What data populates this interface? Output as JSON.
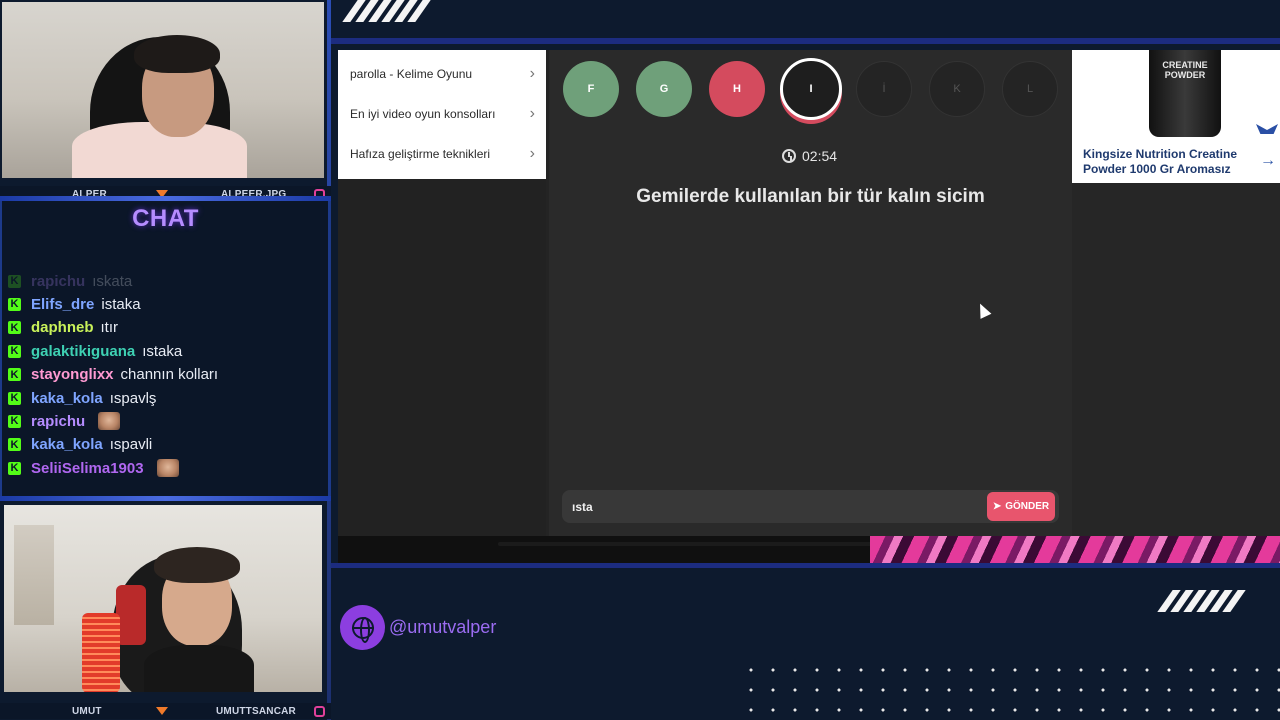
{
  "stream": {
    "streamer_top": {
      "name": "ALPER",
      "handle": "ALPEER.JPG"
    },
    "streamer_bottom": {
      "name": "UMUT",
      "handle": "UMUTTSANCAR"
    },
    "social_handle": "@umutvalper"
  },
  "chat": {
    "title": "CHAT",
    "messages": [
      {
        "user": "rapichu",
        "text": "ıskata",
        "color": "#b58cff",
        "faded": true
      },
      {
        "user": "Elifs_dre",
        "text": "istaka",
        "color": "#7fa5ff"
      },
      {
        "user": "daphneb",
        "text": "ıtır",
        "color": "#c9f25a"
      },
      {
        "user": "galaktikiguana",
        "text": "ıstaka",
        "color": "#3ed1b3"
      },
      {
        "user": "stayonglixx",
        "text": "channın kolları",
        "color": "#ff9ad2"
      },
      {
        "user": "kaka_kola",
        "text": "ıspavlş",
        "color": "#7fa5ff"
      },
      {
        "user": "rapichu",
        "text": "",
        "color": "#b58cff",
        "emote": true
      },
      {
        "user": "kaka_kola",
        "text": "ıspavli",
        "color": "#7fa5ff"
      },
      {
        "user": "SeliiSelima1903",
        "text": "",
        "color": "#b067f0",
        "emote": true
      }
    ]
  },
  "suggestions": [
    {
      "label": "parolla - Kelime Oyunu"
    },
    {
      "label": "En iyi video oyun konsolları"
    },
    {
      "label": "Hafıza geliştirme teknikleri"
    }
  ],
  "game": {
    "letters": [
      {
        "letter": "F",
        "state": "done"
      },
      {
        "letter": "G",
        "state": "done"
      },
      {
        "letter": "H",
        "state": "wrong"
      },
      {
        "letter": "I",
        "state": "active"
      },
      {
        "letter": "İ",
        "state": "pending"
      },
      {
        "letter": "K",
        "state": "pending"
      },
      {
        "letter": "L",
        "state": "pending"
      }
    ],
    "timer": "02:54",
    "question": "Gemilerde kullanılan bir tür kalın sicim",
    "answer_value": "ısta",
    "send_label": "GÖNDER"
  },
  "ad": {
    "product_label": "CREATINE POWDER",
    "brand": "KINGSIZE",
    "text": "Kingsize Nutrition Creatine Powder 1000 Gr Aromasız"
  },
  "colors": {
    "done": "#6fa07a",
    "wrong": "#d44b5e",
    "accent_purple": "#8c3ee0",
    "send_button": "#e8556d"
  }
}
